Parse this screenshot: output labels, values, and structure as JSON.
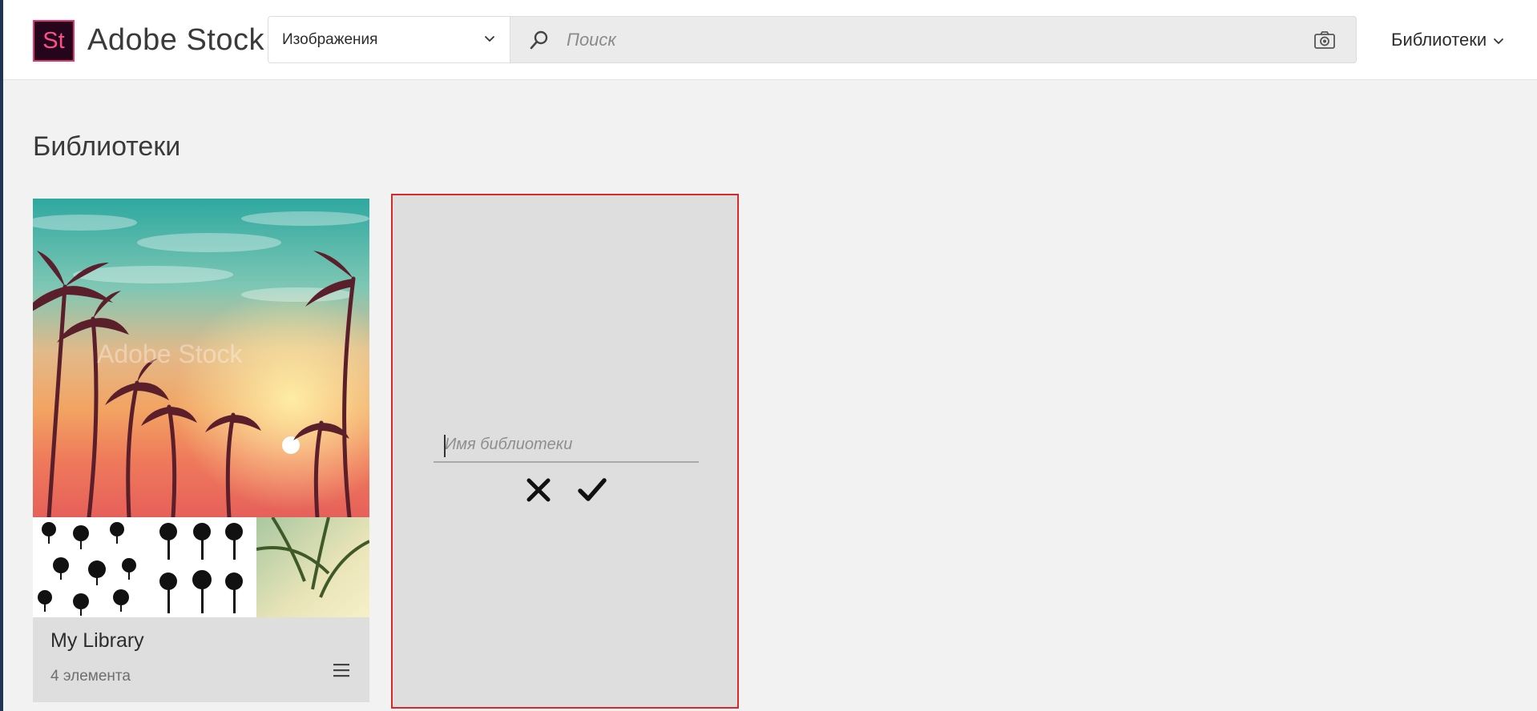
{
  "header": {
    "logo_text": "St",
    "brand": "Adobe Stock",
    "scope_selected": "Изображения",
    "search_placeholder": "Поиск",
    "libraries_menu": "Библиотеки"
  },
  "main": {
    "title": "Библиотеки",
    "libraries": [
      {
        "name": "My Library",
        "count_label": "4 элемента",
        "hero_watermark": "Adobe Stock"
      }
    ],
    "new_library": {
      "name_placeholder": "Имя библиотеки"
    }
  },
  "colors": {
    "logo_bg": "#25051c",
    "logo_accent": "#ff4f87",
    "highlight_border": "#d42a2a",
    "page_bg": "#f2f2f2"
  },
  "icons": {
    "scope_chevron": "chevron-down-icon",
    "search": "search-icon",
    "camera": "camera-icon",
    "menu_chevron": "chevron-down-icon",
    "card_menu": "hamburger-menu-icon",
    "cancel": "close-icon",
    "confirm": "checkmark-icon"
  }
}
